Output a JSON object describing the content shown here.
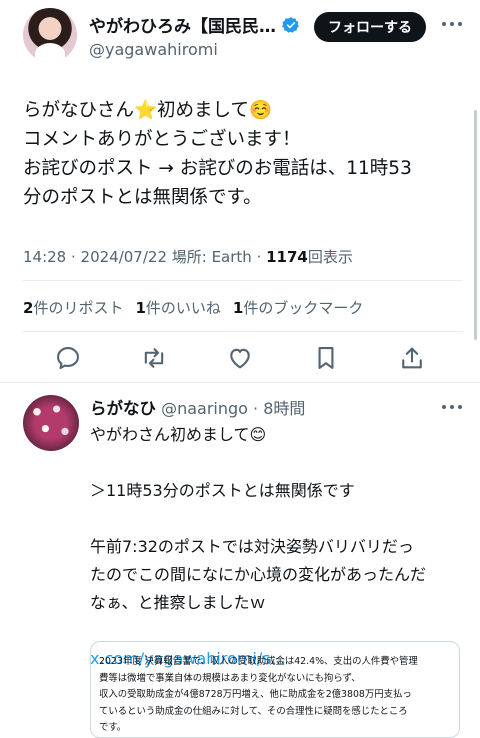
{
  "main_post": {
    "display_name": "やがわひろみ【国民民…",
    "handle": "@yagawahiromi",
    "follow_label": "フォローする",
    "body_lines": [
      "らがなひさん⭐初めまして☺️",
      "コメントありがとうございます！",
      "お詫びのポスト → お詫びのお電話は、11時53",
      "分のポストとは無関係です。"
    ],
    "timestamp": "14:28 · 2024/07/22 場所: Earth · ",
    "views_count": "1174",
    "views_label": "回表示",
    "stats": {
      "reposts_count": "2",
      "reposts_label": "件のリポスト",
      "likes_count": "1",
      "likes_label": "件のいいね",
      "bookmarks_count": "1",
      "bookmarks_label": "件のブックマーク"
    },
    "action_icons": [
      "reply-icon",
      "repost-icon",
      "like-icon",
      "bookmark-icon",
      "share-icon"
    ]
  },
  "reply": {
    "name": "らがなひ",
    "handle": "@naaringo",
    "time": "· 8時間",
    "lines": [
      "やがわさん初めまして😊",
      "",
      "＞11時53分のポストとは無関係です",
      "",
      "午前7:32のポストでは対決姿勢バリバリだっ",
      "たのでこの間になにか心境の変化があったんだ",
      "なぁ、と推察しましたｗ",
      ""
    ],
    "link": "x.com/yagawahiromi/s...",
    "quote_lines": [
      "2023年度 決算報告書で、収入の受取助成金は42.4%、支出の人件費や管理",
      "費等は微増で事業自体の規模はあまり変化がないにも拘らず、",
      "収入の受取助成金が4億8728万円増え、他に助成金を2億3808万円支払っ",
      "ているという助成金の仕組みに対して、その合理性に疑問を感じたところ",
      "です。"
    ]
  },
  "colors": {
    "accent": "#1d9bf0",
    "text": "#0f1419",
    "muted": "#536471",
    "border": "#cfd9de"
  }
}
